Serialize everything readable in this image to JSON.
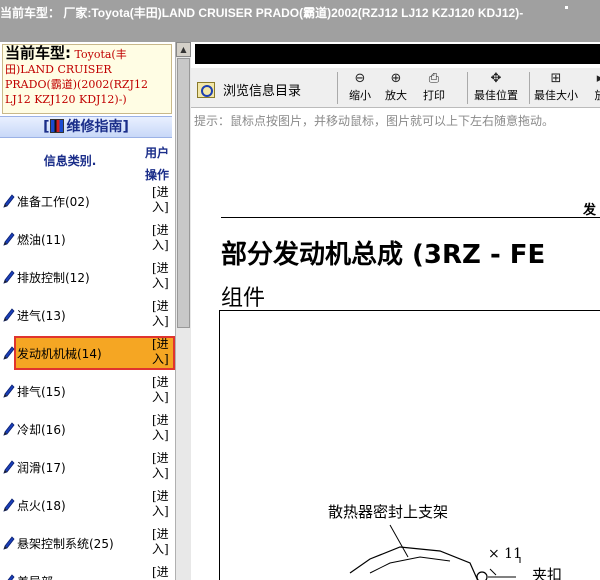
{
  "titlebar": {
    "text": "当前车型：  厂家:Toyota(丰田)LAND CRUISER PRADO(霸道)2002(RZJ12 LJ12 KZJ120 KDJ12)-"
  },
  "car_box": {
    "label": "当前车型:",
    "value": " Toyota(丰田)LAND CRUISER PRADO(霸道)(2002(RZJ12 LJ12 KZJ120 KDJ12)-)"
  },
  "guide": {
    "label": "维修指南",
    "bracket_open": "[",
    "bracket_close": "]"
  },
  "table_header": {
    "category": "信息类别.",
    "op_line1": "用户",
    "op_line2": "操作"
  },
  "categories": [
    {
      "label": "准备工作(02)",
      "op1": "[进",
      "op2": "入]"
    },
    {
      "label": "燃油(11)",
      "op1": "[进",
      "op2": "入]"
    },
    {
      "label": "排放控制(12)",
      "op1": "[进",
      "op2": "入]"
    },
    {
      "label": "进气(13)",
      "op1": "[进",
      "op2": "入]"
    },
    {
      "label": "发动机机械(14)",
      "op1": "[进",
      "op2": "入]"
    },
    {
      "label": "排气(15)",
      "op1": "[进",
      "op2": "入]"
    },
    {
      "label": "冷却(16)",
      "op1": "[进",
      "op2": "入]"
    },
    {
      "label": "润滑(17)",
      "op1": "[进",
      "op2": "入]"
    },
    {
      "label": "点火(18)",
      "op1": "[进",
      "op2": "入]"
    },
    {
      "label": "悬架控制系统(25)",
      "op1": "[进",
      "op2": "入]"
    },
    {
      "label": "差异部",
      "op1": "[进",
      "op2": ""
    }
  ],
  "selected_index": 4,
  "toolbar": {
    "browse_label": "浏览信息目录",
    "zoom_out": "缩小",
    "zoom_in": "放大",
    "print": "打印",
    "best_position": "最佳位置",
    "best_size": "最佳大小",
    "more": "放"
  },
  "hint": "提示：鼠标点按图片，并移动鼠标，图片就可以上下左右随意拖动。",
  "document": {
    "corner": "发",
    "title": "部分发动机总成 (3RZ - FE",
    "subtitle": "组件",
    "fig_label": "散热器密封上支架",
    "fig_qty": "× 11",
    "fig_clip": "夹扣"
  },
  "colors": {
    "selected_bg": "#f5a623",
    "selected_border": "#e0342e",
    "car_value": "#c00000",
    "header_text": "#1b2e8a"
  }
}
